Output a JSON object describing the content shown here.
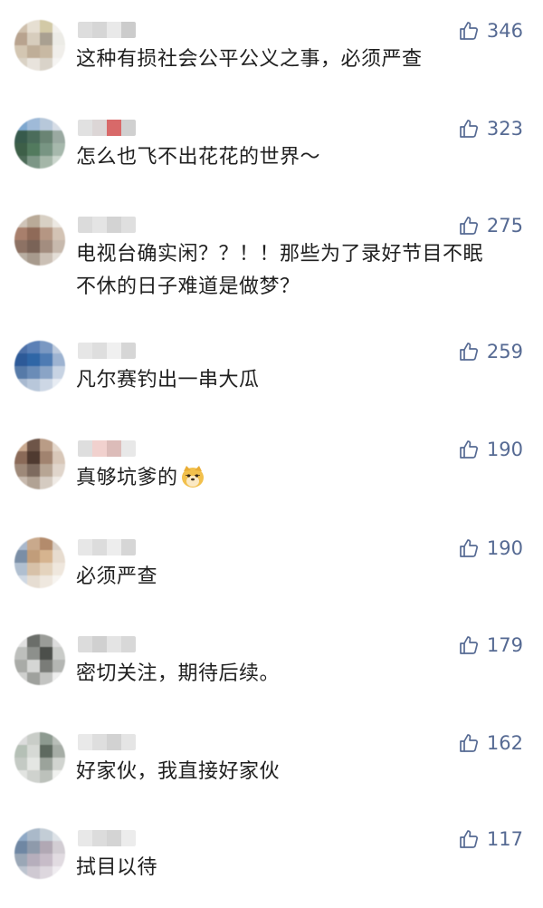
{
  "icons": {
    "like": "thumbs-up-icon",
    "emoji": "doge-emoji-icon"
  },
  "colors": {
    "like_text": "#566a93",
    "comment_text": "#202020",
    "background": "#ffffff"
  },
  "comments": [
    {
      "text": "这种有损社会公平公义之事，必须严查",
      "likes": "346",
      "avatar": [
        "#cfc0ad",
        "#e6dfd2",
        "#d2c9a6",
        "#f2f0ec",
        "#b8a38f",
        "#d7cdbd",
        "#a9a091",
        "#ecebe6",
        "#d3c6b2",
        "#bfae98",
        "#c8b9a3",
        "#f0eeea",
        "#dad2c5",
        "#e8e3dc",
        "#d9d3c9",
        "#f5f4f2"
      ],
      "name": [
        "#d8d8d8",
        "#cfcfcf",
        "#e6e6e6",
        "#c4c4c4"
      ]
    },
    {
      "text": "怎么也飞不出花花的世界～",
      "likes": "323",
      "avatar": [
        "#7ea7cf",
        "#9fbad8",
        "#b7c8da",
        "#d6dde6",
        "#375a4c",
        "#4b6c5b",
        "#6a8474",
        "#9aa9a1",
        "#3d5f48",
        "#527a5e",
        "#789583",
        "#a6b8ac",
        "#4d6b58",
        "#7c9686",
        "#a4b6a8",
        "#cbd6cd"
      ],
      "name": [
        "#dcdcdc",
        "#d7d0cf",
        "#d2504f",
        "#c8c8c8"
      ]
    },
    {
      "text": "电视台确实闲？？！！那些为了录好节目不眠\n不休的日子难道是做梦？",
      "likes": "275",
      "avatar": [
        "#cfc4b8",
        "#b9aa98",
        "#d8d0c4",
        "#ece8e2",
        "#a87f6c",
        "#8f6a58",
        "#b59683",
        "#d3c3b4",
        "#8d7264",
        "#7a6357",
        "#a38d7f",
        "#c7b9ad",
        "#b8aea2",
        "#a79a8d",
        "#cbc0b5",
        "#e4ded7"
      ],
      "name": [
        "#d5d5d5",
        "#e0e0e0",
        "#cccccc",
        "#dadada"
      ]
    },
    {
      "text": "凡尔赛钓出一串大瓜",
      "likes": "259",
      "avatar": [
        "#4c70a8",
        "#5b80b6",
        "#7a98c2",
        "#bcc9dc",
        "#2d5a98",
        "#2f66a6",
        "#4e7bb3",
        "#9db3d1",
        "#567aa8",
        "#6a8cb7",
        "#8aa4c6",
        "#c7d3e3",
        "#a8b9d0",
        "#b8c7da",
        "#cdd7e5",
        "#e7ecf3"
      ],
      "name": [
        "#e2e2e2",
        "#d9d9d9",
        "#eeeeee",
        "#d0d0d0"
      ]
    },
    {
      "text": "真够坑爹的",
      "likes": "190",
      "emoji": true,
      "avatar": [
        "#c9a98f",
        "#6e5548",
        "#b99c86",
        "#e3d6ca",
        "#8a6a58",
        "#4f3a30",
        "#a1836f",
        "#d8c7b8",
        "#9e8979",
        "#7d6a5e",
        "#b7a594",
        "#e0d5cb",
        "#c7b9ad",
        "#b1a294",
        "#d5cbc1",
        "#efeae5"
      ],
      "name": [
        "#d9d9d9",
        "#efc9c6",
        "#d7b1ad",
        "#e4e4e4"
      ]
    },
    {
      "text": "必须严查",
      "likes": "190",
      "avatar": [
        "#a9b8cc",
        "#c9a98c",
        "#b38b6c",
        "#d9cfc6",
        "#7a8ea6",
        "#c19d7a",
        "#d6b48f",
        "#e7dccf",
        "#b0bfd0",
        "#d7c1a8",
        "#e4d3bd",
        "#efe7dd",
        "#cfd8e3",
        "#e6ddd2",
        "#efe8df",
        "#f7f4f0"
      ],
      "name": [
        "#e3e3e3",
        "#d6d6d6",
        "#ebebeb",
        "#cfcfcf"
      ]
    },
    {
      "text": "密切关注，期待后续。",
      "likes": "179",
      "avatar": [
        "#e0e0e0",
        "#6b6e6a",
        "#9a9c98",
        "#dcdcdc",
        "#bdbfbc",
        "#8d908c",
        "#4c4f4b",
        "#c9cbc8",
        "#a9aba7",
        "#d5d6d4",
        "#7a7c78",
        "#b4b6b3",
        "#cfd0ce",
        "#9fa19d",
        "#c3c4c2",
        "#eeeeee"
      ],
      "name": [
        "#d6d6d6",
        "#c8c8c8",
        "#e0e0e0",
        "#d2d2d2"
      ]
    },
    {
      "text": "好家伙，我直接好家伙",
      "likes": "162",
      "avatar": [
        "#dcdcdc",
        "#c9cdc8",
        "#8d9a90",
        "#b8beb8",
        "#b5c0b6",
        "#d6d9d5",
        "#5e6a60",
        "#a6ada6",
        "#c4cac4",
        "#e4e6e3",
        "#9ba39b",
        "#d1d4d0",
        "#e2e4e1",
        "#cfd2ce",
        "#bcc1bb",
        "#f0f1ef"
      ],
      "name": [
        "#e6e6e6",
        "#d9d9d9",
        "#cbcbcb",
        "#e1e1e1"
      ]
    },
    {
      "text": "拭目以待",
      "likes": "117",
      "avatar": [
        "#8fa9c6",
        "#aab9c9",
        "#c3cdd6",
        "#dde2e7",
        "#6f87a3",
        "#8e9aab",
        "#b1a8b4",
        "#d2cdd3",
        "#9aa7b6",
        "#b6aebc",
        "#c7bcc8",
        "#e1dbe1",
        "#bcc4cf",
        "#cfc9d2",
        "#ddd7de",
        "#efecf0"
      ],
      "name": [
        "#e4e4e4",
        "#d7d7d7",
        "#cdcdcd",
        "#e9e9e9"
      ]
    }
  ]
}
